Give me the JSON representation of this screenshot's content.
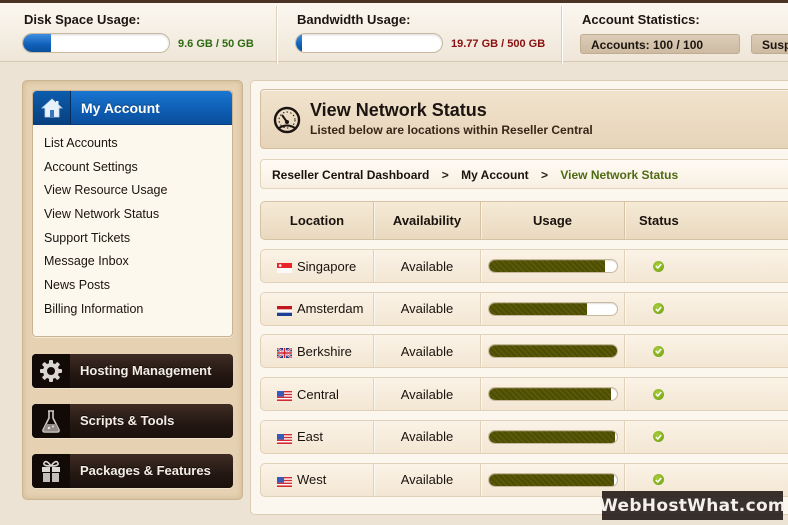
{
  "topbar": {
    "disk": {
      "title": "Disk Space Usage:",
      "text": "9.6 GB / 50 GB",
      "fraction": 0.192,
      "text_color": "#2e6b12"
    },
    "bandwidth": {
      "title": "Bandwidth Usage:",
      "text": "19.77 GB / 500 GB",
      "fraction": 0.04,
      "text_color": "#8a1010"
    },
    "account_stats": {
      "title": "Account Statistics:",
      "accounts": "Accounts: 100 / 100",
      "suspended": "Susp"
    }
  },
  "sidebar": {
    "active_section": {
      "label": "My Account",
      "icon": "home-icon"
    },
    "items": [
      {
        "label": "List Accounts"
      },
      {
        "label": "Account Settings"
      },
      {
        "label": "View Resource Usage"
      },
      {
        "label": "View Network Status"
      },
      {
        "label": "Support Tickets"
      },
      {
        "label": "Message Inbox"
      },
      {
        "label": "News Posts"
      },
      {
        "label": "Billing Information"
      }
    ],
    "sections": [
      {
        "label": "Hosting Management",
        "icon": "gear-icon"
      },
      {
        "label": "Scripts & Tools",
        "icon": "flask-icon"
      },
      {
        "label": "Packages & Features",
        "icon": "gift-icon"
      }
    ]
  },
  "page": {
    "title": "View Network Status",
    "subtitle": "Listed below are locations within Reseller Central",
    "icon": "speedometer-icon"
  },
  "breadcrumb": {
    "items": [
      "Reseller Central Dashboard",
      "My Account"
    ],
    "current": "View Network Status",
    "separator": ">"
  },
  "table": {
    "columns": [
      "Location",
      "Availability",
      "Usage",
      "Status"
    ],
    "rows": [
      {
        "location": "Singapore",
        "flag": "singapore-flag-icon",
        "availability": "Available",
        "usage": 0.91,
        "status": "ok"
      },
      {
        "location": "Amsterdam",
        "flag": "netherlands-flag-icon",
        "availability": "Available",
        "usage": 0.77,
        "status": "ok"
      },
      {
        "location": "Berkshire",
        "flag": "uk-flag-icon",
        "availability": "Available",
        "usage": 1.0,
        "status": "ok"
      },
      {
        "location": "Central",
        "flag": "us-flag-icon",
        "availability": "Available",
        "usage": 0.96,
        "status": "ok"
      },
      {
        "location": "East",
        "flag": "us-flag-icon",
        "availability": "Available",
        "usage": 0.99,
        "status": "ok"
      },
      {
        "location": "West",
        "flag": "us-flag-icon",
        "availability": "Available",
        "usage": 0.98,
        "status": "ok"
      }
    ]
  },
  "colors": {
    "accent_blue": "#0e5eb5",
    "usage_fill": "#545405",
    "status_ok": "#7fae1c",
    "breadcrumb_current": "#4f6b13"
  },
  "watermark": "WebHostWhat.com"
}
